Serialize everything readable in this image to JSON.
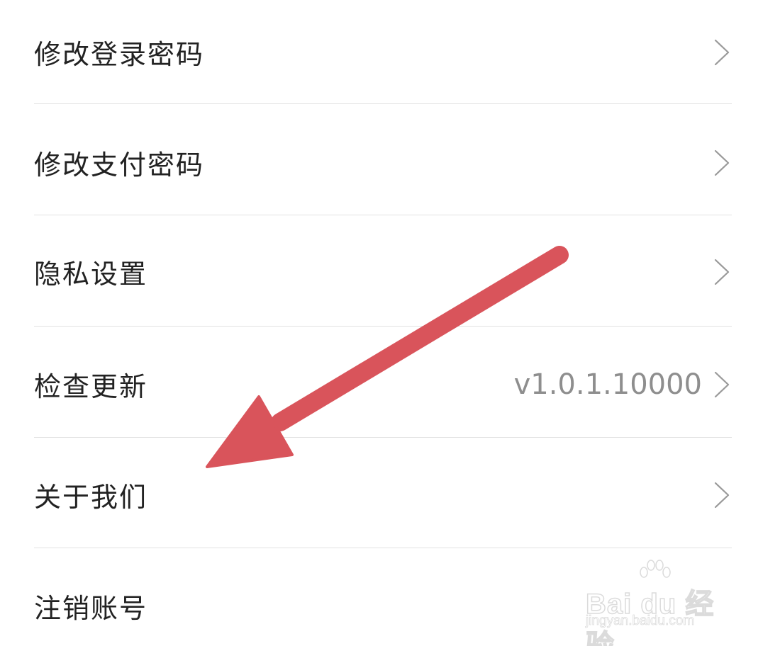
{
  "settings": {
    "items": [
      {
        "label": "修改登录密码",
        "value": ""
      },
      {
        "label": "修改支付密码",
        "value": ""
      },
      {
        "label": "隐私设置",
        "value": ""
      },
      {
        "label": "检查更新",
        "value": "v1.0.1.10000"
      },
      {
        "label": "关于我们",
        "value": ""
      },
      {
        "label": "注销账号",
        "value": ""
      }
    ]
  },
  "annotation": {
    "arrow_color": "#d9545b",
    "icon": "arrow-pointer-icon"
  },
  "watermark": {
    "brand": "Bai du 经验",
    "url": "jingyan.baidu.com"
  },
  "colors": {
    "text": "#222222",
    "secondary_text": "#8e8e8e",
    "divider": "#e2e2e2",
    "chevron": "#9a9a9a"
  }
}
